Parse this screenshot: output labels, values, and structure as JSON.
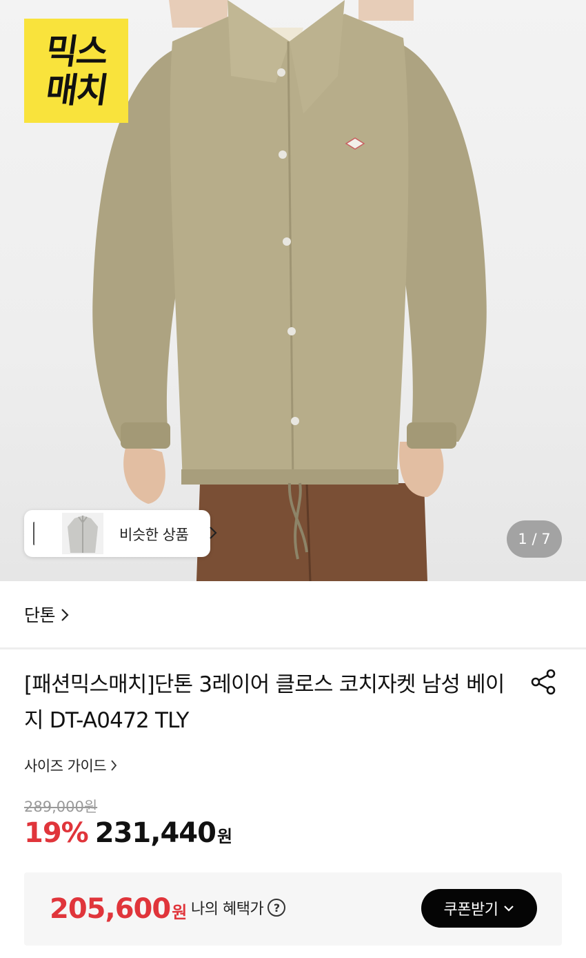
{
  "hero": {
    "logo_line1": "믹스",
    "logo_line2": "매치",
    "similar_label": "비슷한 상품",
    "image_counter": "1 / 7"
  },
  "brand": {
    "name": "단톤"
  },
  "product": {
    "title": "[패션믹스매치]단톤 3레이어 클로스 코치자켓 남성 베이지 DT-A0472 TLY",
    "size_guide_label": "사이즈 가이드",
    "original_price": "289,000원",
    "discount_rate": "19%",
    "sale_price": "231,440",
    "currency": "원"
  },
  "benefit": {
    "price": "205,600",
    "currency": "원",
    "label": "나의 혜택가",
    "help_icon": "question-circle-icon",
    "coupon_button": "쿠폰받기"
  },
  "colors": {
    "accent_red": "#e0353b",
    "logo_yellow": "#f9e33c",
    "jacket_beige": "#b7ad8a"
  }
}
